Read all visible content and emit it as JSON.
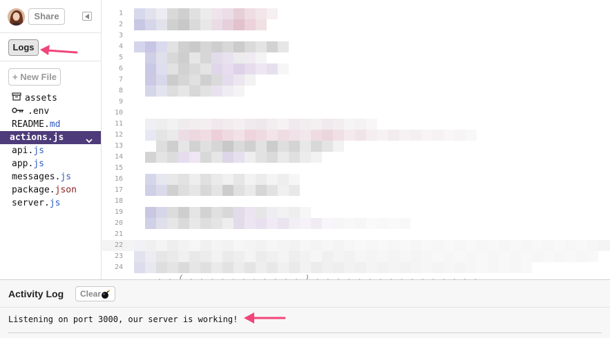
{
  "sidebar": {
    "share_label": "Share",
    "logs_label": "Logs",
    "new_file_label": "+ New File",
    "files": [
      {
        "name": "assets",
        "ext": "",
        "icon": "archive-icon"
      },
      {
        "name": ".env",
        "ext": "",
        "icon": "key-icon"
      },
      {
        "name": "README.",
        "ext": "md"
      },
      {
        "name": "actions.js",
        "ext": "",
        "active": true
      },
      {
        "name": "api.",
        "ext": "js"
      },
      {
        "name": "app.",
        "ext": "js"
      },
      {
        "name": "messages.",
        "ext": "js"
      },
      {
        "name": "package.",
        "ext": "json"
      },
      {
        "name": "server.",
        "ext": "js"
      }
    ]
  },
  "editor": {
    "line_numbers": [
      "1",
      "2",
      "3",
      "4",
      "5",
      "6",
      "7",
      "8",
      "9",
      "10",
      "11",
      "12",
      "13",
      "14",
      "15",
      "16",
      "17",
      "18",
      "19",
      "20",
      "21",
      "22",
      "23",
      "24"
    ],
    "current_line": "22"
  },
  "activity_log": {
    "title": "Activity Log",
    "clear_label": "Clear",
    "message": "Listening on port 3000, our server is working!"
  },
  "colors": {
    "active_file_bg": "#4d3b7a",
    "annotation_arrow": "#f0457a",
    "file_ext_blue": "#2f5bc0",
    "file_ext_json": "#8b2222"
  }
}
